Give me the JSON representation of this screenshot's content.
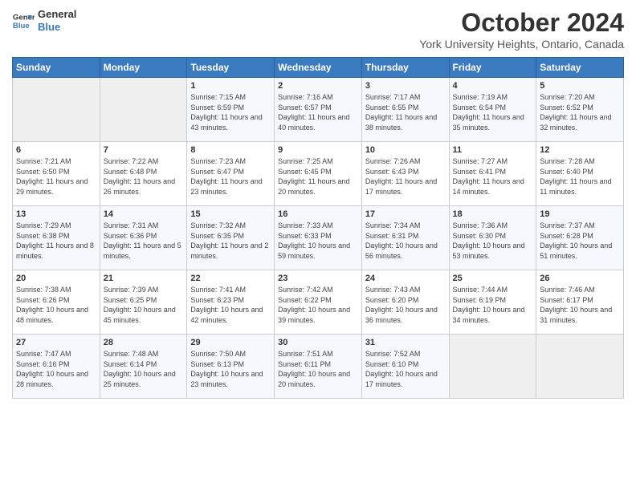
{
  "header": {
    "logo_line1": "General",
    "logo_line2": "Blue",
    "month": "October 2024",
    "location": "York University Heights, Ontario, Canada"
  },
  "weekdays": [
    "Sunday",
    "Monday",
    "Tuesday",
    "Wednesday",
    "Thursday",
    "Friday",
    "Saturday"
  ],
  "weeks": [
    [
      {
        "day": "",
        "detail": ""
      },
      {
        "day": "",
        "detail": ""
      },
      {
        "day": "1",
        "detail": "Sunrise: 7:15 AM\nSunset: 6:59 PM\nDaylight: 11 hours and 43 minutes."
      },
      {
        "day": "2",
        "detail": "Sunrise: 7:16 AM\nSunset: 6:57 PM\nDaylight: 11 hours and 40 minutes."
      },
      {
        "day": "3",
        "detail": "Sunrise: 7:17 AM\nSunset: 6:55 PM\nDaylight: 11 hours and 38 minutes."
      },
      {
        "day": "4",
        "detail": "Sunrise: 7:19 AM\nSunset: 6:54 PM\nDaylight: 11 hours and 35 minutes."
      },
      {
        "day": "5",
        "detail": "Sunrise: 7:20 AM\nSunset: 6:52 PM\nDaylight: 11 hours and 32 minutes."
      }
    ],
    [
      {
        "day": "6",
        "detail": "Sunrise: 7:21 AM\nSunset: 6:50 PM\nDaylight: 11 hours and 29 minutes."
      },
      {
        "day": "7",
        "detail": "Sunrise: 7:22 AM\nSunset: 6:48 PM\nDaylight: 11 hours and 26 minutes."
      },
      {
        "day": "8",
        "detail": "Sunrise: 7:23 AM\nSunset: 6:47 PM\nDaylight: 11 hours and 23 minutes."
      },
      {
        "day": "9",
        "detail": "Sunrise: 7:25 AM\nSunset: 6:45 PM\nDaylight: 11 hours and 20 minutes."
      },
      {
        "day": "10",
        "detail": "Sunrise: 7:26 AM\nSunset: 6:43 PM\nDaylight: 11 hours and 17 minutes."
      },
      {
        "day": "11",
        "detail": "Sunrise: 7:27 AM\nSunset: 6:41 PM\nDaylight: 11 hours and 14 minutes."
      },
      {
        "day": "12",
        "detail": "Sunrise: 7:28 AM\nSunset: 6:40 PM\nDaylight: 11 hours and 11 minutes."
      }
    ],
    [
      {
        "day": "13",
        "detail": "Sunrise: 7:29 AM\nSunset: 6:38 PM\nDaylight: 11 hours and 8 minutes."
      },
      {
        "day": "14",
        "detail": "Sunrise: 7:31 AM\nSunset: 6:36 PM\nDaylight: 11 hours and 5 minutes."
      },
      {
        "day": "15",
        "detail": "Sunrise: 7:32 AM\nSunset: 6:35 PM\nDaylight: 11 hours and 2 minutes."
      },
      {
        "day": "16",
        "detail": "Sunrise: 7:33 AM\nSunset: 6:33 PM\nDaylight: 10 hours and 59 minutes."
      },
      {
        "day": "17",
        "detail": "Sunrise: 7:34 AM\nSunset: 6:31 PM\nDaylight: 10 hours and 56 minutes."
      },
      {
        "day": "18",
        "detail": "Sunrise: 7:36 AM\nSunset: 6:30 PM\nDaylight: 10 hours and 53 minutes."
      },
      {
        "day": "19",
        "detail": "Sunrise: 7:37 AM\nSunset: 6:28 PM\nDaylight: 10 hours and 51 minutes."
      }
    ],
    [
      {
        "day": "20",
        "detail": "Sunrise: 7:38 AM\nSunset: 6:26 PM\nDaylight: 10 hours and 48 minutes."
      },
      {
        "day": "21",
        "detail": "Sunrise: 7:39 AM\nSunset: 6:25 PM\nDaylight: 10 hours and 45 minutes."
      },
      {
        "day": "22",
        "detail": "Sunrise: 7:41 AM\nSunset: 6:23 PM\nDaylight: 10 hours and 42 minutes."
      },
      {
        "day": "23",
        "detail": "Sunrise: 7:42 AM\nSunset: 6:22 PM\nDaylight: 10 hours and 39 minutes."
      },
      {
        "day": "24",
        "detail": "Sunrise: 7:43 AM\nSunset: 6:20 PM\nDaylight: 10 hours and 36 minutes."
      },
      {
        "day": "25",
        "detail": "Sunrise: 7:44 AM\nSunset: 6:19 PM\nDaylight: 10 hours and 34 minutes."
      },
      {
        "day": "26",
        "detail": "Sunrise: 7:46 AM\nSunset: 6:17 PM\nDaylight: 10 hours and 31 minutes."
      }
    ],
    [
      {
        "day": "27",
        "detail": "Sunrise: 7:47 AM\nSunset: 6:16 PM\nDaylight: 10 hours and 28 minutes."
      },
      {
        "day": "28",
        "detail": "Sunrise: 7:48 AM\nSunset: 6:14 PM\nDaylight: 10 hours and 25 minutes."
      },
      {
        "day": "29",
        "detail": "Sunrise: 7:50 AM\nSunset: 6:13 PM\nDaylight: 10 hours and 23 minutes."
      },
      {
        "day": "30",
        "detail": "Sunrise: 7:51 AM\nSunset: 6:11 PM\nDaylight: 10 hours and 20 minutes."
      },
      {
        "day": "31",
        "detail": "Sunrise: 7:52 AM\nSunset: 6:10 PM\nDaylight: 10 hours and 17 minutes."
      },
      {
        "day": "",
        "detail": ""
      },
      {
        "day": "",
        "detail": ""
      }
    ]
  ]
}
